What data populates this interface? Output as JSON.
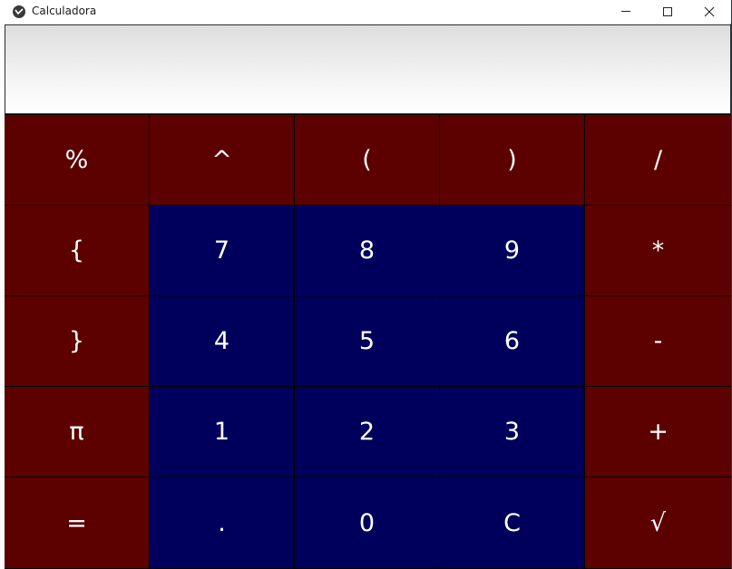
{
  "window": {
    "title": "Calculadora",
    "app_icon": "app-logo-icon",
    "controls": [
      "minimize-icon",
      "maximize-icon",
      "close-icon"
    ]
  },
  "display": {
    "value": ""
  },
  "colors": {
    "operator_key": "#5c0000",
    "digit_key": "#00005c",
    "key_text": "#ffffff"
  },
  "keypad": {
    "rows": [
      [
        {
          "label": "%",
          "kind": "op",
          "name": "key-percent"
        },
        {
          "label": "^",
          "kind": "op",
          "name": "key-power"
        },
        {
          "label": "(",
          "kind": "op",
          "name": "key-open-paren"
        },
        {
          "label": ")",
          "kind": "op",
          "name": "key-close-paren"
        },
        {
          "label": "/",
          "kind": "op",
          "name": "key-divide"
        }
      ],
      [
        {
          "label": "{",
          "kind": "op",
          "name": "key-open-brace"
        },
        {
          "label": "7",
          "kind": "num",
          "name": "key-7"
        },
        {
          "label": "8",
          "kind": "num",
          "name": "key-8"
        },
        {
          "label": "9",
          "kind": "num",
          "name": "key-9"
        },
        {
          "label": "*",
          "kind": "op",
          "name": "key-multiply"
        }
      ],
      [
        {
          "label": "}",
          "kind": "op",
          "name": "key-close-brace"
        },
        {
          "label": "4",
          "kind": "num",
          "name": "key-4"
        },
        {
          "label": "5",
          "kind": "num",
          "name": "key-5"
        },
        {
          "label": "6",
          "kind": "num",
          "name": "key-6"
        },
        {
          "label": "-",
          "kind": "op",
          "name": "key-subtract"
        }
      ],
      [
        {
          "label": "π",
          "kind": "op",
          "name": "key-pi"
        },
        {
          "label": "1",
          "kind": "num",
          "name": "key-1"
        },
        {
          "label": "2",
          "kind": "num",
          "name": "key-2"
        },
        {
          "label": "3",
          "kind": "num",
          "name": "key-3"
        },
        {
          "label": "+",
          "kind": "op",
          "name": "key-add"
        }
      ],
      [
        {
          "label": "=",
          "kind": "op",
          "name": "key-equals"
        },
        {
          "label": ".",
          "kind": "num",
          "name": "key-decimal"
        },
        {
          "label": "0",
          "kind": "num",
          "name": "key-0"
        },
        {
          "label": "C",
          "kind": "num",
          "name": "key-clear"
        },
        {
          "label": "√",
          "kind": "op",
          "name": "key-sqrt"
        }
      ]
    ]
  }
}
